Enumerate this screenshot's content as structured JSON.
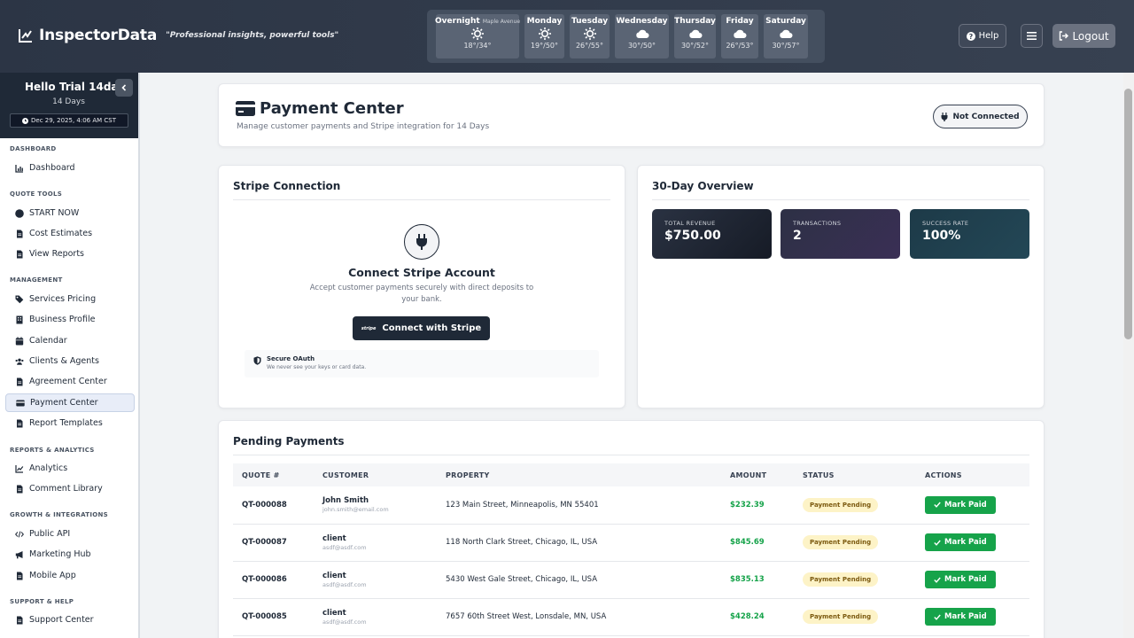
{
  "header": {
    "brand": "InspectorData",
    "tagline": "\"Professional insights, powerful tools\"",
    "help_label": "Help",
    "logout_label": "Logout"
  },
  "weather": [
    {
      "day": "Overnight",
      "note": "Maple Avenue",
      "icon": "sun-icon",
      "temp": "18°/34°"
    },
    {
      "day": "Monday",
      "icon": "sun-icon",
      "temp": "19°/50°"
    },
    {
      "day": "Tuesday",
      "icon": "sun-icon",
      "temp": "26°/55°"
    },
    {
      "day": "Wednesday",
      "icon": "cloud-icon",
      "temp": "30°/50°"
    },
    {
      "day": "Thursday",
      "icon": "cloud-icon",
      "temp": "30°/52°"
    },
    {
      "day": "Friday",
      "icon": "cloud-icon",
      "temp": "26°/53°"
    },
    {
      "day": "Saturday",
      "icon": "cloud-icon",
      "temp": "30°/57°"
    }
  ],
  "sidebar": {
    "greeting": "Hello Trial 14day!",
    "days": "14 Days",
    "datetime": "Dec 29, 2025, 4:06 AM CST",
    "sections": {
      "dashboard": "DASHBOARD",
      "quote_tools": "QUOTE TOOLS",
      "management": "MANAGEMENT",
      "reports": "REPORTS & ANALYTICS",
      "growth": "GROWTH & INTEGRATIONS",
      "support": "SUPPORT & HELP"
    },
    "items": {
      "dashboard": "Dashboard",
      "start_now": "START NOW",
      "cost_estimates": "Cost Estimates",
      "view_reports": "View Reports",
      "services_pricing": "Services Pricing",
      "business_profile": "Business Profile",
      "calendar": "Calendar",
      "clients_agents": "Clients & Agents",
      "agreement_center": "Agreement Center",
      "payment_center": "Payment Center",
      "report_templates": "Report Templates",
      "analytics": "Analytics",
      "comment_library": "Comment Library",
      "public_api": "Public API",
      "marketing_hub": "Marketing Hub",
      "mobile_app": "Mobile App",
      "support_center": "Support Center"
    }
  },
  "page": {
    "title": "Payment Center",
    "subtitle": "Manage customer payments and Stripe integration for 14 Days",
    "status": "Not Connected"
  },
  "stripe": {
    "title": "Stripe Connection",
    "heading": "Connect Stripe Account",
    "description": "Accept customer payments securely with direct deposits to your bank.",
    "button_mark": "stripe",
    "button_label": "Connect with Stripe",
    "oauth_title": "Secure OAuth",
    "oauth_sub": "We never see your keys or card data."
  },
  "overview": {
    "title": "30-Day Overview",
    "stats": [
      {
        "label": "TOTAL REVENUE",
        "value": "$750.00"
      },
      {
        "label": "TRANSACTIONS",
        "value": "2"
      },
      {
        "label": "SUCCESS RATE",
        "value": "100%"
      }
    ]
  },
  "pending": {
    "title": "Pending Payments",
    "columns": [
      "QUOTE #",
      "CUSTOMER",
      "PROPERTY",
      "AMOUNT",
      "STATUS",
      "ACTIONS"
    ],
    "rows": [
      {
        "quote": "QT-000088",
        "name": "John Smith",
        "email": "john.smith@email.com",
        "property": "123 Main Street, Minneapolis, MN 55401",
        "amount": "$232.39",
        "status": "Payment Pending",
        "action": "Mark Paid"
      },
      {
        "quote": "QT-000087",
        "name": "client",
        "email": "asdf@asdf.com",
        "property": "118 North Clark Street, Chicago, IL, USA",
        "amount": "$845.69",
        "status": "Payment Pending",
        "action": "Mark Paid"
      },
      {
        "quote": "QT-000086",
        "name": "client",
        "email": "asdf@asdf.com",
        "property": "5430 West Gale Street, Chicago, IL, USA",
        "amount": "$835.13",
        "status": "Payment Pending",
        "action": "Mark Paid"
      },
      {
        "quote": "QT-000085",
        "name": "client",
        "email": "asdf@asdf.com",
        "property": "7657 60th Street West, Lonsdale, MN, USA",
        "amount": "$428.24",
        "status": "Payment Pending",
        "action": "Mark Paid"
      }
    ]
  }
}
